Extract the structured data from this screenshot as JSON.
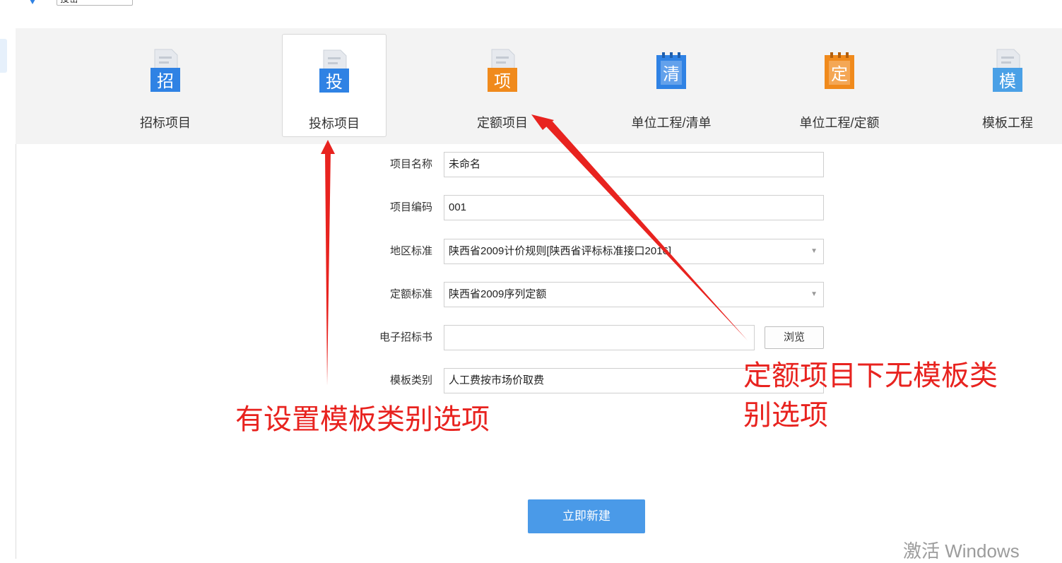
{
  "top_bar": {
    "select_value": "投密"
  },
  "types": [
    {
      "label": "招标项目",
      "glyph": "招",
      "color": "#2f82e4",
      "icon": "document-zhao-icon"
    },
    {
      "label": "投标项目",
      "glyph": "投",
      "color": "#2f82e4",
      "icon": "document-tou-icon",
      "selected": true
    },
    {
      "label": "定额项目",
      "glyph": "项",
      "color": "#f08a1c",
      "icon": "document-xiang-icon"
    },
    {
      "label": "单位工程/清单",
      "glyph": "清",
      "color": "#2f82e4",
      "icon": "notepad-qing-icon"
    },
    {
      "label": "单位工程/定额",
      "glyph": "定",
      "color": "#f08a1c",
      "icon": "notepad-ding-icon"
    },
    {
      "label": "模板工程",
      "glyph": "模",
      "color": "#4aa0e6",
      "icon": "document-mo-icon"
    }
  ],
  "form": {
    "project_name": {
      "label": "项目名称",
      "value": "未命名"
    },
    "project_code": {
      "label": "项目编码",
      "value": "001"
    },
    "region_standard": {
      "label": "地区标准",
      "value": "陕西省2009计价规则[陕西省评标标准接口2016]"
    },
    "quota_standard": {
      "label": "定额标准",
      "value": "陕西省2009序列定额"
    },
    "tender_doc": {
      "label": "电子招标书",
      "value": "",
      "browse_label": "浏览"
    },
    "template_type": {
      "label": "模板类别",
      "value": "人工费按市场价取费"
    }
  },
  "create_button": "立即新建",
  "annotations": {
    "left": "有设置模板类别选项",
    "right_line1": "定额项目下无模板类",
    "right_line2": "别选项"
  },
  "watermark": "激活 Windows",
  "colors": {
    "accent": "#4a9ae8",
    "annotation": "#e8231f",
    "orange": "#f08a1c",
    "blue": "#2f82e4"
  }
}
